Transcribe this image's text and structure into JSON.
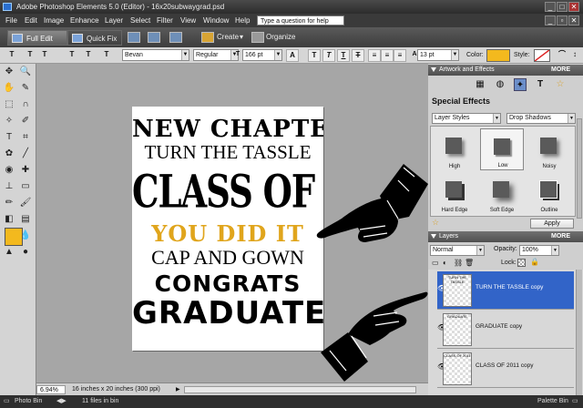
{
  "window": {
    "title": "Adobe Photoshop Elements 5.0 (Editor) - 16x20subwaygrad.psd"
  },
  "menu": {
    "items": [
      "File",
      "Edit",
      "Image",
      "Enhance",
      "Layer",
      "Select",
      "Filter",
      "View",
      "Window",
      "Help"
    ],
    "help_placeholder": "Type a question for help"
  },
  "modebar": {
    "full_edit": "Full Edit",
    "quick_fix": "Quick Fix",
    "create": "Create",
    "organize": "Organize"
  },
  "options": {
    "font_family": "Bevan",
    "font_style": "Regular",
    "font_size": "166 pt",
    "leading": "13 pt",
    "color_label": "Color:",
    "style_label": "Style:",
    "color": "#f3b91e"
  },
  "canvas": {
    "lines": [
      "NEW CHAPTER",
      "TURN THE TASSLE",
      "CLASS OF 2011",
      "YOU DID IT",
      "CAP AND GOWN",
      "CONGRATS",
      "GRADUATE"
    ],
    "accent": "#e0a51c",
    "background": "#a6a6a6"
  },
  "status": {
    "zoom": "6.94%",
    "doc_size": "16 inches x 20 inches (300 ppi)"
  },
  "bottombar": {
    "photo_bin": "Photo Bin",
    "files_in_bin": "11 files in bin",
    "palette_bin": "Palette Bin"
  },
  "artwork_panel": {
    "title": "Artwork and Effects",
    "more": "MORE",
    "section": "Special Effects",
    "category": "Layer Styles",
    "subcategory": "Drop Shadows",
    "styles": [
      "High",
      "Low",
      "Noisy",
      "Hard Edge",
      "Soft Edge",
      "Outline"
    ],
    "apply": "Apply"
  },
  "layers_panel": {
    "title": "Layers",
    "more": "MORE",
    "blend_mode": "Normal",
    "opacity_label": "Opacity:",
    "opacity": "100%",
    "lock_label": "Lock:",
    "layers": [
      {
        "name": "TURN THE TASSLE copy",
        "thumb": "TURN THE TASSLE"
      },
      {
        "name": "GRADUATE copy",
        "thumb": "GRADUATE"
      },
      {
        "name": "CLASS OF 2011 copy",
        "thumb": "CLASS OF 2011"
      }
    ]
  }
}
